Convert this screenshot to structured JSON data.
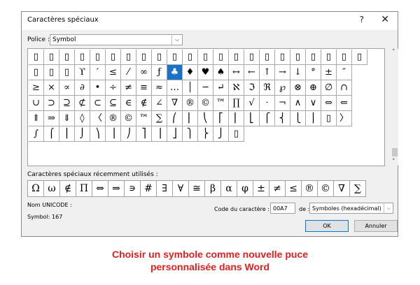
{
  "dialog": {
    "title": "Caractères spéciaux",
    "help": "?",
    "close": "✕"
  },
  "font": {
    "label": "Police :",
    "value": "Symbol",
    "arrow": "⌵"
  },
  "grid": {
    "rows": [
      [
        "▯",
        "▯",
        "▯",
        "▯",
        "▯",
        "▯",
        "▯",
        "▯",
        "▯",
        "▯",
        "▯",
        "▯",
        "▯",
        "▯",
        "▯",
        "▯",
        "▯",
        "▯",
        "▯",
        "▯",
        "▯",
        "▯"
      ],
      [
        "▯",
        "▯",
        "▯",
        "ϒ",
        "′",
        "≤",
        "⁄",
        "∞",
        "ƒ",
        "♣",
        "♦",
        "♥",
        "♠",
        "↔",
        "←",
        "↑",
        "→",
        "↓",
        "°",
        "±",
        "″",
        ""
      ],
      [
        "≥",
        "×",
        "∝",
        "∂",
        "•",
        "÷",
        "≠",
        "≡",
        "≈",
        "…",
        "│",
        "─",
        "↵",
        "ℵ",
        "ℑ",
        "ℜ",
        "℘",
        "⊗",
        "⊕",
        "∅",
        "∩",
        ""
      ],
      [
        "∪",
        "⊃",
        "⊇",
        "⊄",
        "⊂",
        "⊆",
        "∈",
        "∉",
        "∠",
        "∇",
        "®",
        "©",
        "™",
        "∏",
        "√",
        "⋅",
        "¬",
        "∧",
        "∨",
        "⇔",
        "⇐",
        ""
      ],
      [
        "⇑",
        "⇒",
        "⇓",
        "◊",
        "〈",
        "®",
        "©",
        "™",
        "∑",
        "⎛",
        "⎜",
        "⎝",
        "⎡",
        "⎢",
        "⎣",
        "⎧",
        "⎨",
        "⎩",
        "⎪",
        "▯",
        "〉",
        ""
      ],
      [
        "∫",
        "⌠",
        "⎮",
        "⌡",
        "⎞",
        "⎟",
        "⎠",
        "⎤",
        "⎥",
        "⎦",
        "⎫",
        "⎬",
        "⎭",
        "▯",
        "",
        "",
        "",
        "",
        "",
        "",
        "",
        ""
      ]
    ],
    "selected": {
      "row": 1,
      "col": 9
    }
  },
  "scrollbar": {
    "up": "˄",
    "down": "˅"
  },
  "recent": {
    "label": "Caractères spéciaux récemment utilisés :",
    "symbols": [
      "Ω",
      "ω",
      "∉",
      "Π",
      "⇔",
      "⇒",
      "∍",
      "#",
      "∃",
      "∀",
      "≅",
      "β",
      "α",
      "φ",
      "±",
      "≠",
      "≤",
      "®",
      "©",
      "∇",
      "∑"
    ]
  },
  "unicode": {
    "name_label": "Nom UNICODE :",
    "value": "Symbol: 167"
  },
  "code": {
    "label": "Code du caractère :",
    "value": "00A7",
    "de_label": "de :",
    "de_value": "Symboles (hexadécimal)"
  },
  "buttons": {
    "ok": "OK",
    "cancel": "Annuler"
  },
  "caption": {
    "line1": "Choisir un symbole comme nouvelle puce",
    "line2": "personnalisée dans Word"
  },
  "colors": {
    "selection": "#1a73c9",
    "caption": "#e02020"
  }
}
